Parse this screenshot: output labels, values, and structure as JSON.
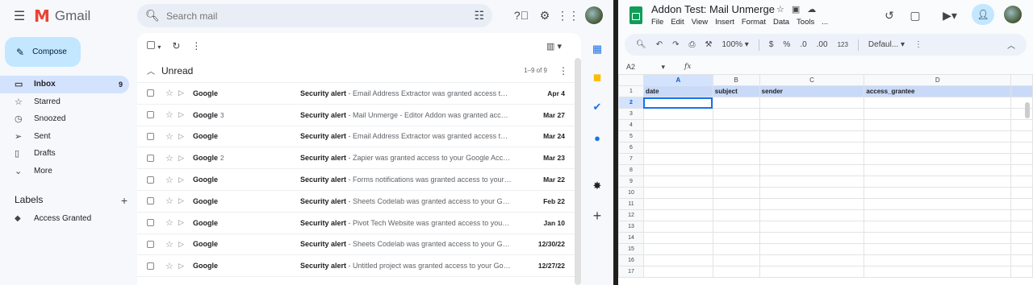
{
  "gmail": {
    "app_name": "Gmail",
    "search_placeholder": "Search mail",
    "compose_label": "Compose",
    "nav": [
      {
        "label": "Inbox",
        "count": "9",
        "icon": "inbox-icon"
      },
      {
        "label": "Starred",
        "count": "",
        "icon": "star-icon"
      },
      {
        "label": "Snoozed",
        "count": "",
        "icon": "clock-icon"
      },
      {
        "label": "Sent",
        "count": "",
        "icon": "send-icon"
      },
      {
        "label": "Drafts",
        "count": "",
        "icon": "draft-icon"
      },
      {
        "label": "More",
        "count": "",
        "icon": "chevron-down-icon"
      }
    ],
    "labels_heading": "Labels",
    "labels": [
      {
        "label": "Access Granted",
        "icon": "label-icon"
      }
    ],
    "section_title": "Unread",
    "range": "1–9 of 9",
    "emails": [
      {
        "sender": "Google",
        "count": "",
        "subject": "Security alert",
        "snippet": " - Email Address Extractor was granted access to your Google Account",
        "date": "Apr 4"
      },
      {
        "sender": "Google",
        "count": "3",
        "subject": "Security alert",
        "snippet": " - Mail Unmerge - Editor Addon was granted access to your Google Account",
        "date": "Mar 27"
      },
      {
        "sender": "Google",
        "count": "",
        "subject": "Security alert",
        "snippet": " - Email Address Extractor was granted access to your Google Account",
        "date": "Mar 24"
      },
      {
        "sender": "Google",
        "count": "2",
        "subject": "Security alert",
        "snippet": " - Zapier was granted access to your Google Account",
        "date": "Mar 23"
      },
      {
        "sender": "Google",
        "count": "",
        "subject": "Security alert",
        "snippet": " - Forms notifications was granted access to your Google Account",
        "date": "Mar 22"
      },
      {
        "sender": "Google",
        "count": "",
        "subject": "Security alert",
        "snippet": " - Sheets Codelab was granted access to your Google Account",
        "date": "Feb 22"
      },
      {
        "sender": "Google",
        "count": "",
        "subject": "Security alert",
        "snippet": " - Pivot Tech Website was granted access to your Google Account",
        "date": "Jan 10"
      },
      {
        "sender": "Google",
        "count": "",
        "subject": "Security alert",
        "snippet": " - Sheets Codelab was granted access to your Google Account",
        "date": "12/30/22"
      },
      {
        "sender": "Google",
        "count": "",
        "subject": "Security alert",
        "snippet": " - Untitled project was granted access to your Google Account",
        "date": "12/27/22"
      }
    ]
  },
  "sheets": {
    "doc_title": "Addon Test: Mail Unmerge",
    "menus": [
      "File",
      "Edit",
      "View",
      "Insert",
      "Format",
      "Data",
      "Tools",
      "..."
    ],
    "zoom": "100%",
    "currency": "$",
    "percent": "%",
    "dec_less": ".0",
    "dec_more": ".00",
    "number_fmt": "123",
    "font": "Defaul...",
    "name_box": "A2",
    "fx": "fx",
    "columns": [
      "A",
      "B",
      "C",
      "D"
    ],
    "header_row": [
      "date",
      "subject",
      "sender",
      "access_grantee"
    ],
    "row_numbers": [
      "1",
      "2",
      "3",
      "4",
      "5",
      "6",
      "7",
      "8",
      "9",
      "10",
      "11",
      "12",
      "13",
      "14",
      "15",
      "16",
      "17"
    ]
  }
}
